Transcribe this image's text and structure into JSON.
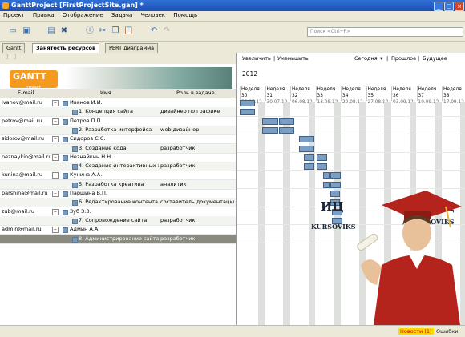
{
  "window": {
    "title": "GanttProject [FirstProjectSite.gan] *"
  },
  "menu": [
    "Проект",
    "Правка",
    "Отображение",
    "Задача",
    "Человек",
    "Помощь"
  ],
  "search": {
    "placeholder": "Поиск <Ctrl+F>"
  },
  "tabs": [
    "Gantt",
    "Занятость ресурсов",
    "PERT диаграмма"
  ],
  "logo": {
    "main": "GANTT",
    "sub": "project"
  },
  "table": {
    "headers": [
      "E-mail",
      "Имя",
      "Роль в задаче"
    ],
    "rows": [
      {
        "email": "ivanov@mail.ru",
        "name": "Иванов И.И.",
        "role": "",
        "child": false
      },
      {
        "email": "",
        "name": "1. Концепция сайта",
        "role": "дизайнер по графике",
        "child": true
      },
      {
        "email": "petrov@mail.ru",
        "name": "Петров П.П.",
        "role": "",
        "child": false
      },
      {
        "email": "",
        "name": "2. Разработка интерфейса",
        "role": "web дизайнер",
        "child": true
      },
      {
        "email": "sidorov@mail.ru",
        "name": "Сидоров С.С.",
        "role": "",
        "child": false
      },
      {
        "email": "",
        "name": "3. Создание кода",
        "role": "разработчик",
        "child": true
      },
      {
        "email": "neznaykin@mail.ru",
        "name": "Незнайкин Н.Н.",
        "role": "",
        "child": false
      },
      {
        "email": "",
        "name": "4. Создание интерактивных э...",
        "role": "разработчик",
        "child": true
      },
      {
        "email": "kunina@mail.ru",
        "name": "Кунина А.А.",
        "role": "",
        "child": false
      },
      {
        "email": "",
        "name": "5. Разработка креатива",
        "role": "аналитик",
        "child": true
      },
      {
        "email": "parshina@mail.ru",
        "name": "Паршина В.П.",
        "role": "",
        "child": false
      },
      {
        "email": "",
        "name": "6. Редактирование контента",
        "role": "составитель документации",
        "child": true
      },
      {
        "email": "zub@mail.ru",
        "name": "Зуб З.З.",
        "role": "",
        "child": false
      },
      {
        "email": "",
        "name": "7. Сопровождение сайта",
        "role": "разработчик",
        "child": true
      },
      {
        "email": "admin@mail.ru",
        "name": "Админ А.А.",
        "role": "",
        "child": false
      },
      {
        "email": "",
        "name": "8. Администрирование сайта",
        "role": "разработчик",
        "child": true,
        "selected": true
      }
    ]
  },
  "chart_toolbar": {
    "zoom_in": "Увеличить",
    "zoom_out": "Уменьшить",
    "today": "Сегодня",
    "prev": "Прошлое",
    "next": "Будущее"
  },
  "year": "2012",
  "weeks": [
    {
      "label": "Неделя 30",
      "date": "23.07.12"
    },
    {
      "label": "Неделя 31",
      "date": "30.07.12"
    },
    {
      "label": "Неделя 32",
      "date": "06.08.12"
    },
    {
      "label": "Неделя 33",
      "date": "13.08.12"
    },
    {
      "label": "Неделя 34",
      "date": "20.08.12"
    },
    {
      "label": "Неделя 35",
      "date": "27.08.12"
    },
    {
      "label": "Неделя 36",
      "date": "03.09.12"
    },
    {
      "label": "Неделя 37",
      "date": "10.09.12"
    },
    {
      "label": "Неделя 38",
      "date": "17.09.12"
    }
  ],
  "bars": [
    {
      "row": 0,
      "start": 0,
      "len": 0.55
    },
    {
      "row": 1,
      "start": 0,
      "len": 0.55
    },
    {
      "row": 2,
      "start": 0.9,
      "len": 0.55
    },
    {
      "row": 2,
      "start": 1.55,
      "len": 0.55
    },
    {
      "row": 3,
      "start": 0.9,
      "len": 0.55
    },
    {
      "row": 3,
      "start": 1.55,
      "len": 0.55
    },
    {
      "row": 4,
      "start": 2.35,
      "len": 0.55
    },
    {
      "row": 5,
      "start": 2.35,
      "len": 0.55
    },
    {
      "row": 6,
      "start": 2.55,
      "len": 0.35
    },
    {
      "row": 6,
      "start": 3.05,
      "len": 0.35
    },
    {
      "row": 7,
      "start": 2.55,
      "len": 0.35
    },
    {
      "row": 7,
      "start": 3.05,
      "len": 0.35
    },
    {
      "row": 8,
      "start": 3.3,
      "len": 0.2
    },
    {
      "row": 8,
      "start": 3.6,
      "len": 0.35
    },
    {
      "row": 9,
      "start": 3.3,
      "len": 0.2
    },
    {
      "row": 9,
      "start": 3.6,
      "len": 0.35
    },
    {
      "row": 10,
      "start": 3.6,
      "len": 0.3
    },
    {
      "row": 11,
      "start": 3.6,
      "len": 0.3
    },
    {
      "row": 12,
      "start": 3.65,
      "len": 0.35
    },
    {
      "row": 13,
      "start": 3.65,
      "len": 0.35
    }
  ],
  "watermark": {
    "left_big": "ИЦ",
    "left_small": "KURSOVIKS",
    "right_big": "ИЦ",
    "right_small": "KURSOVIKS"
  },
  "status": {
    "news": "Новости (1)",
    "errors": "Ошибки"
  },
  "colors": {
    "bar": "#7c9ec2",
    "title": "#2f6fd6",
    "news_bg": "#ffd800"
  }
}
